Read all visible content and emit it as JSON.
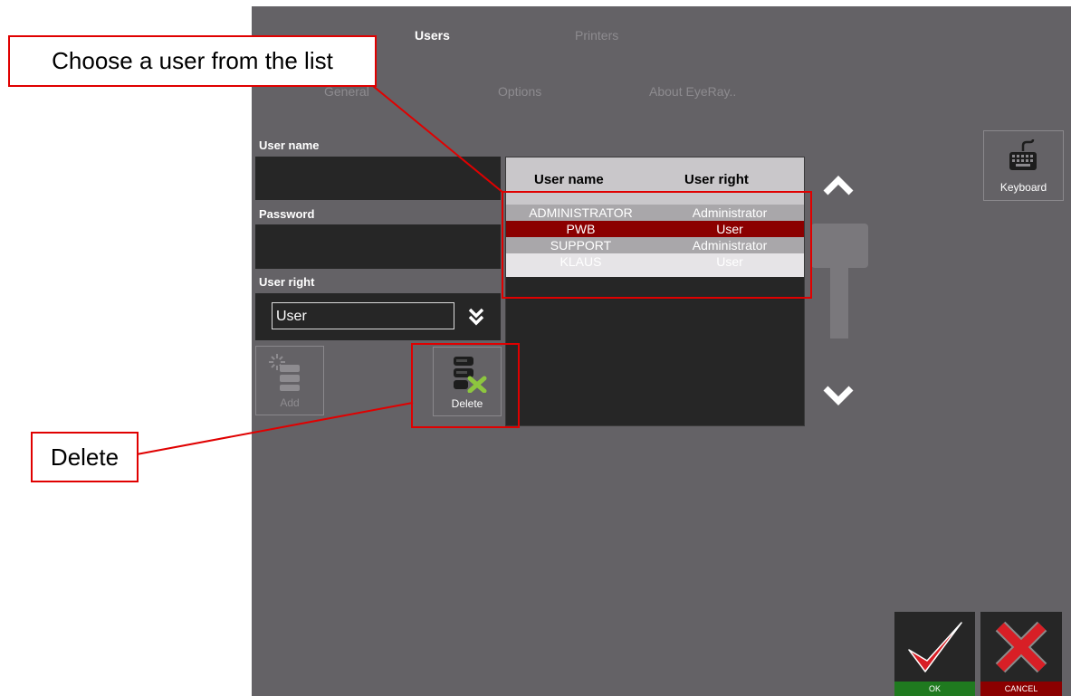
{
  "tabs_top": [
    {
      "label": "Users",
      "active": true
    },
    {
      "label": "Printers",
      "active": false
    }
  ],
  "tabs_sub": [
    {
      "label": "General"
    },
    {
      "label": "Options"
    },
    {
      "label": "About EyeRay.."
    }
  ],
  "form": {
    "username_label": "User name",
    "username_value": "",
    "password_label": "Password",
    "password_value": "",
    "userright_label": "User right",
    "userright_value": "User"
  },
  "buttons": {
    "add": "Add",
    "delete": "Delete",
    "keyboard": "Keyboard",
    "ok": "OK",
    "cancel": "CANCEL"
  },
  "user_list": {
    "columns": [
      "User name",
      "User right"
    ],
    "rows": [
      {
        "name": "ADMINISTRATOR",
        "right": "Administrator"
      },
      {
        "name": "PWB",
        "right": "User"
      },
      {
        "name": "SUPPORT",
        "right": "Administrator"
      },
      {
        "name": "KLAUS",
        "right": "User"
      }
    ],
    "selected_index": 1
  },
  "annotations": {
    "choose_user": "Choose a user from the list",
    "delete": "Delete"
  },
  "colors": {
    "app_bg": "#646266",
    "field_bg": "#262626",
    "selected_row": "#8b0000",
    "annotation": "#e00000",
    "ok_green": "#1f7a1f",
    "cancel_red": "#8b0000"
  }
}
